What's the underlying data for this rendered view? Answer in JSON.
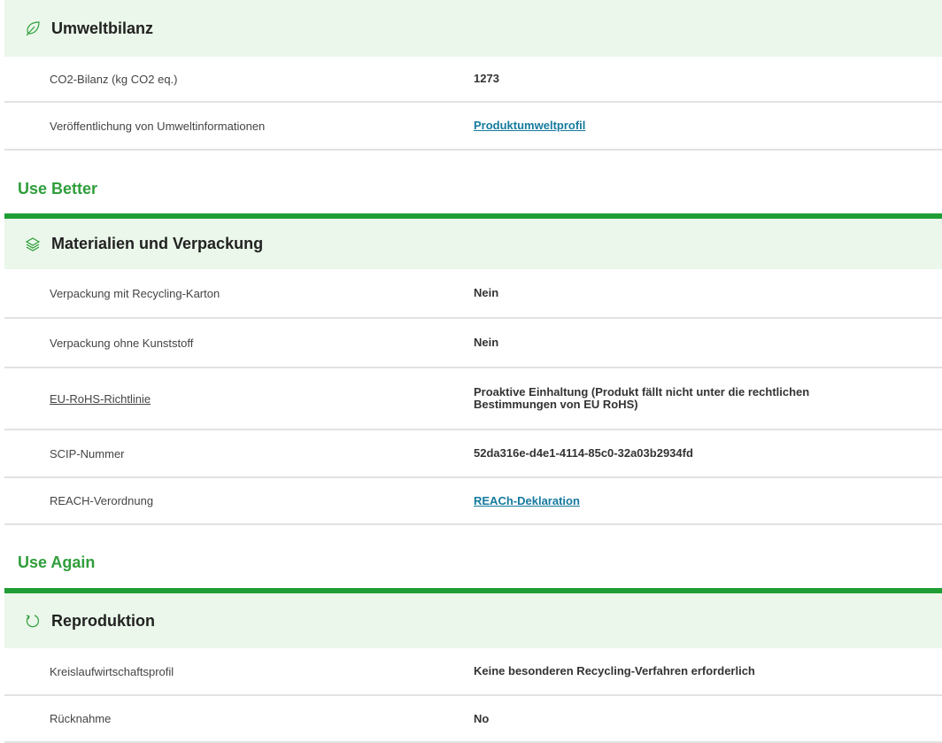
{
  "umweltbilanz": {
    "title": "Umweltbilanz",
    "rows": [
      {
        "label": "CO2-Bilanz (kg CO2 eq.)",
        "value": "1273"
      },
      {
        "label": "Veröffentlichung von Umweltinformationen",
        "value": "Produktumweltprofil"
      }
    ]
  },
  "use_better": {
    "category": "Use Better",
    "section_title": "Materialien und Verpackung",
    "rows": [
      {
        "label": "Verpackung mit Recycling-Karton",
        "value": "Nein"
      },
      {
        "label": "Verpackung ohne Kunststoff",
        "value": "Nein"
      },
      {
        "label": "EU-RoHS-Richtlinie",
        "value": "Proaktive Einhaltung (Produkt fällt nicht unter die rechtlichen Bestimmungen von EU RoHS)"
      },
      {
        "label": "SCIP-Nummer",
        "value": "52da316e-d4e1-4114-85c0-32a03b2934fd"
      },
      {
        "label": "REACH-Verordnung",
        "value": "REACh-Deklaration"
      }
    ]
  },
  "use_again": {
    "category": "Use Again",
    "section_title": "Reproduktion",
    "rows": [
      {
        "label": "Kreislaufwirtschaftsprofil",
        "value": "Keine besonderen Recycling-Verfahren erforderlich"
      },
      {
        "label": "Rücknahme",
        "value": "No"
      }
    ]
  },
  "icons": {
    "umweltbilanz": "leaf-icon",
    "materialien": "layers-icon",
    "reproduktion": "refresh-icon"
  },
  "colors": {
    "section_bg": "#eaf7ea",
    "category_green": "#2f9e3b",
    "bar_green": "#1e9e35",
    "link_blue": "#157a9e"
  }
}
